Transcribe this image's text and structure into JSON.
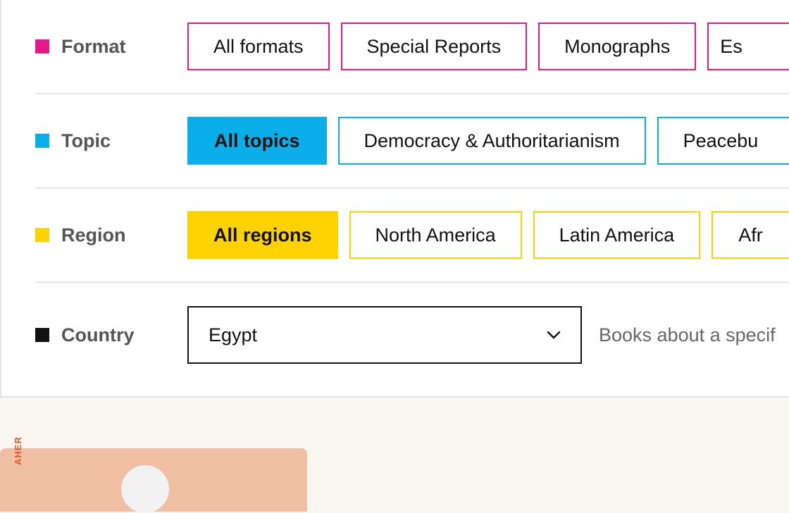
{
  "filters": {
    "format": {
      "label": "Format",
      "color": "#e5178a",
      "options": [
        "All formats",
        "Special Reports",
        "Monographs",
        "Es"
      ]
    },
    "topic": {
      "label": "Topic",
      "color": "#0aaee8",
      "active_text_color": "#111111",
      "options": [
        "All topics",
        "Democracy & Authoritarianism",
        "Peacebu"
      ]
    },
    "region": {
      "label": "Region",
      "color": "#fcd300",
      "options": [
        "All regions",
        "North America",
        "Latin America",
        "Afr"
      ]
    },
    "country": {
      "label": "Country",
      "color": "#111111",
      "selected": "Egypt",
      "hint": "Books about a specif"
    }
  },
  "card": {
    "vertical_text": "AHER"
  }
}
